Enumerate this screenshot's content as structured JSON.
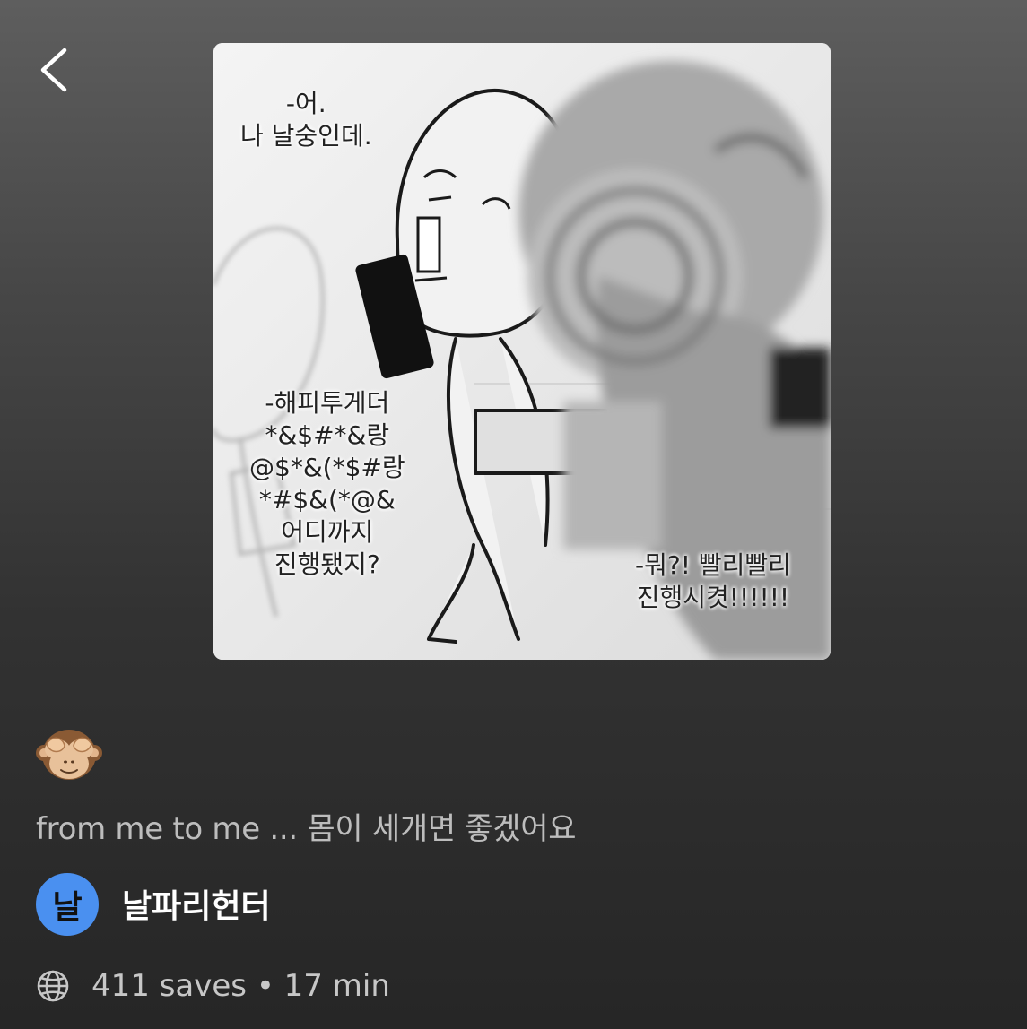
{
  "header": {
    "back_icon": "chevron-left-icon"
  },
  "cover": {
    "bubbles": {
      "top_left": "-어.\n나 날숭인데.",
      "middle_left": "-해피투게더\n*&$#*&랑\n@$*&(*$#랑\n*#$&(*@&\n어디까지\n진행됐지?",
      "bottom_right": "-뭐?! 빨리빨리\n진행시켯!!!!!!"
    }
  },
  "post": {
    "emoji": "see-no-evil-monkey",
    "description": "from me to me ... 몸이 세개면 좋겠어요"
  },
  "author": {
    "avatar_initial": "날",
    "avatar_color": "#4a90f0",
    "name": "날파리헌터"
  },
  "stats": {
    "icon": "globe-icon",
    "text": "411 saves • 17 min"
  }
}
